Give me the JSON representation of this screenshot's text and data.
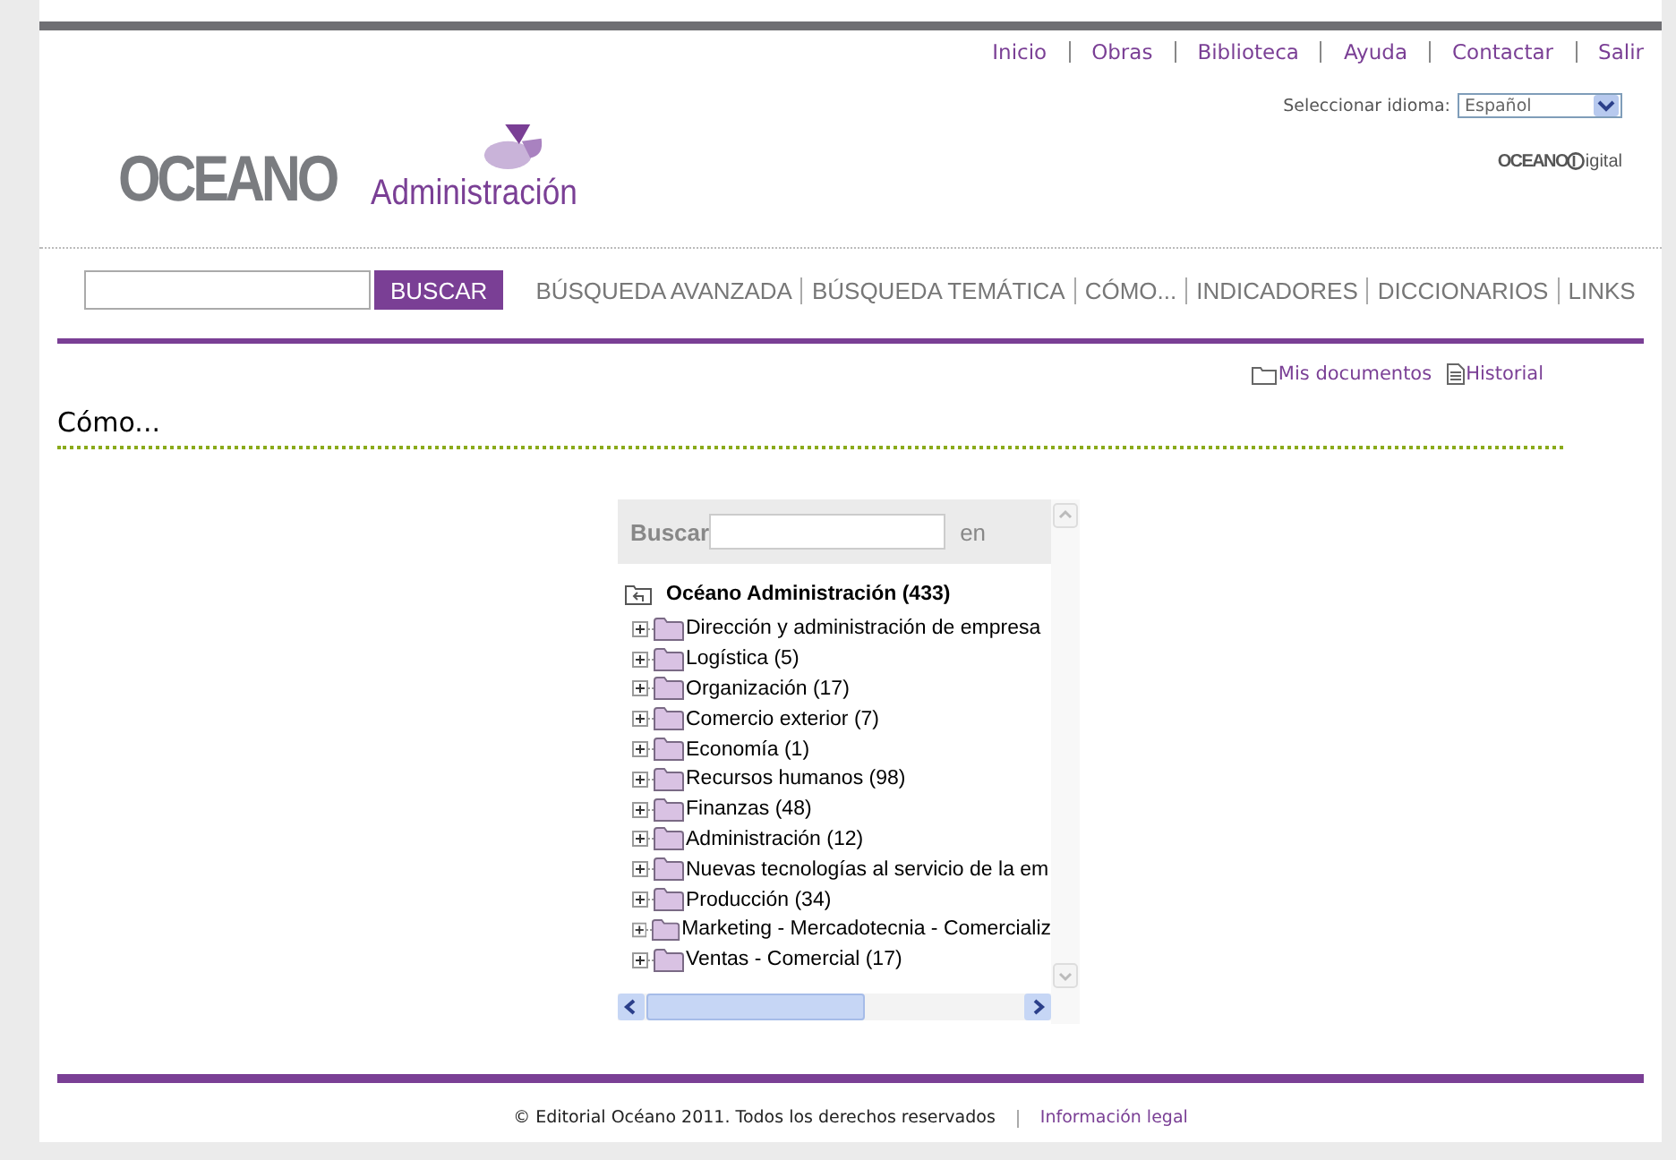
{
  "top_links": [
    "Inicio",
    "Obras",
    "Biblioteca",
    "Ayuda",
    "Contactar",
    "Salir"
  ],
  "language": {
    "label": "Seleccionar idioma:",
    "value": "Español"
  },
  "logo": {
    "brand": "OCEANO",
    "product": "Administración"
  },
  "partner_logo": {
    "brand": "OCEANO",
    "product": "igital"
  },
  "search": {
    "button": "BUSCAR"
  },
  "nav": [
    "BÚSQUEDA AVANZADA",
    "BÚSQUEDA TEMÁTICA",
    "CÓMO...",
    "INDICADORES",
    "DICCIONARIOS",
    "LINKS"
  ],
  "user_links": [
    {
      "kind": "folder",
      "label": "Mis documentos"
    },
    {
      "kind": "document",
      "label": "Historial"
    }
  ],
  "page_title": "Cómo...",
  "tree_panel": {
    "search_label": "Buscar",
    "search_suffix": "en",
    "root": {
      "label": "Océano Administración (433)",
      "expanded": true,
      "children": [
        {
          "label": "Dirección y administración de empresa",
          "expanded": false
        },
        {
          "label": "Logística (5)",
          "expanded": false
        },
        {
          "label": "Organización (17)",
          "expanded": false
        },
        {
          "label": "Comercio exterior (7)",
          "expanded": false
        },
        {
          "label": "Economía (1)",
          "expanded": false
        },
        {
          "label": "Recursos humanos (98)",
          "expanded": false
        },
        {
          "label": "Finanzas (48)",
          "expanded": false
        },
        {
          "label": "Administración (12)",
          "expanded": false
        },
        {
          "label": "Nuevas tecnologías al servicio de la em",
          "expanded": false
        },
        {
          "label": "Producción (34)",
          "expanded": false
        },
        {
          "label": "Marketing - Mercadotecnia - Comercializ",
          "expanded": false
        },
        {
          "label": "Ventas - Comercial (17)",
          "expanded": false
        }
      ]
    }
  },
  "footer": {
    "copyright": "© Editorial Océano 2011. Todos los derechos reservados",
    "link": "Información legal"
  }
}
